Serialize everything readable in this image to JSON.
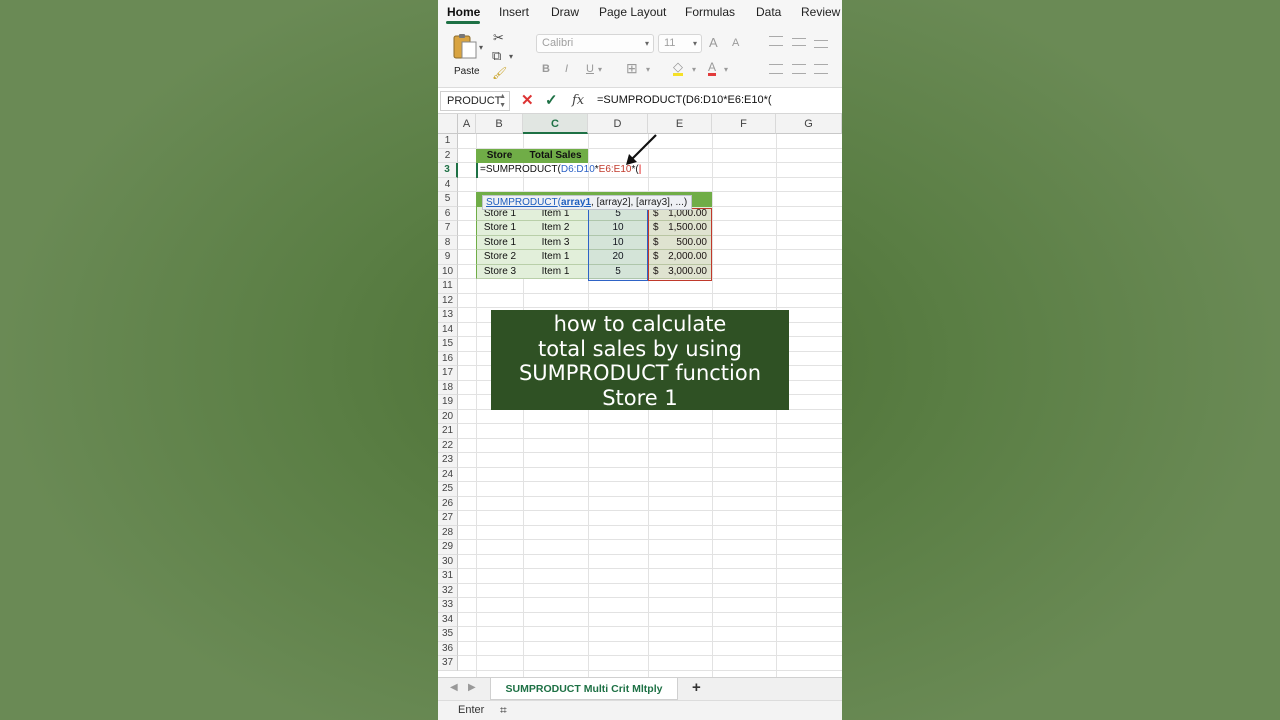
{
  "ribbon_tabs": [
    "Home",
    "Insert",
    "Draw",
    "Page Layout",
    "Formulas",
    "Data",
    "Review"
  ],
  "ribbon": {
    "paste_label": "Paste",
    "font_name": "Calibri",
    "font_size": "11",
    "bold": "B",
    "italic": "I",
    "underline": "U",
    "font_grow": "A",
    "font_shrink": "A",
    "font_color": "A"
  },
  "formula_bar": {
    "name_box": "PRODUCT",
    "fx": "fx",
    "formula": "=SUMPRODUCT(D6:D10*E6:E10*("
  },
  "columns": [
    "A",
    "B",
    "C",
    "D",
    "E",
    "F",
    "G"
  ],
  "rows": [
    "1",
    "2",
    "3",
    "4",
    "5",
    "6",
    "7",
    "8",
    "9",
    "10",
    "11",
    "12",
    "13",
    "14",
    "15",
    "16",
    "17",
    "18",
    "19",
    "20",
    "21",
    "22",
    "23",
    "24",
    "25",
    "26",
    "27",
    "28",
    "29",
    "30",
    "31",
    "32",
    "33",
    "34",
    "35",
    "36",
    "37"
  ],
  "summary_headers": {
    "store": "Store",
    "total_sales": "Total Sales"
  },
  "cell_edit": {
    "prefix": "=SUMPRODUCT(",
    "range1": "D6:D10",
    "op1": "*",
    "range2": "E6:E10",
    "op2": "*(",
    "cursor": "|"
  },
  "tooltip": {
    "fn": "SUMPRODUCT",
    "open": "(",
    "arg1": "array1",
    "rest": ", [array2], [array3], ...)"
  },
  "table_rows": [
    {
      "store": "Store 1",
      "item": "Item 1",
      "qty": "5",
      "cur": "$",
      "price": "1,000.00"
    },
    {
      "store": "Store 1",
      "item": "Item 2",
      "qty": "10",
      "cur": "$",
      "price": "1,500.00"
    },
    {
      "store": "Store 1",
      "item": "Item 3",
      "qty": "10",
      "cur": "$",
      "price": "500.00"
    },
    {
      "store": "Store 2",
      "item": "Item 1",
      "qty": "20",
      "cur": "$",
      "price": "2,000.00"
    },
    {
      "store": "Store 3",
      "item": "Item 1",
      "qty": "5",
      "cur": "$",
      "price": "3,000.00"
    }
  ],
  "caption": [
    "how to calculate",
    "total sales by using",
    "SUMPRODUCT function",
    "Store 1"
  ],
  "sheet_tab": "SUMPRODUCT Multi Crit Mltply",
  "add_sheet": "+",
  "status": "Enter",
  "colors": {
    "accent": "#1e7145",
    "header_green": "#70ad47",
    "range_blue": "#2e63c6",
    "range_red": "#c0392b",
    "caption_bg": "#2f5124"
  }
}
